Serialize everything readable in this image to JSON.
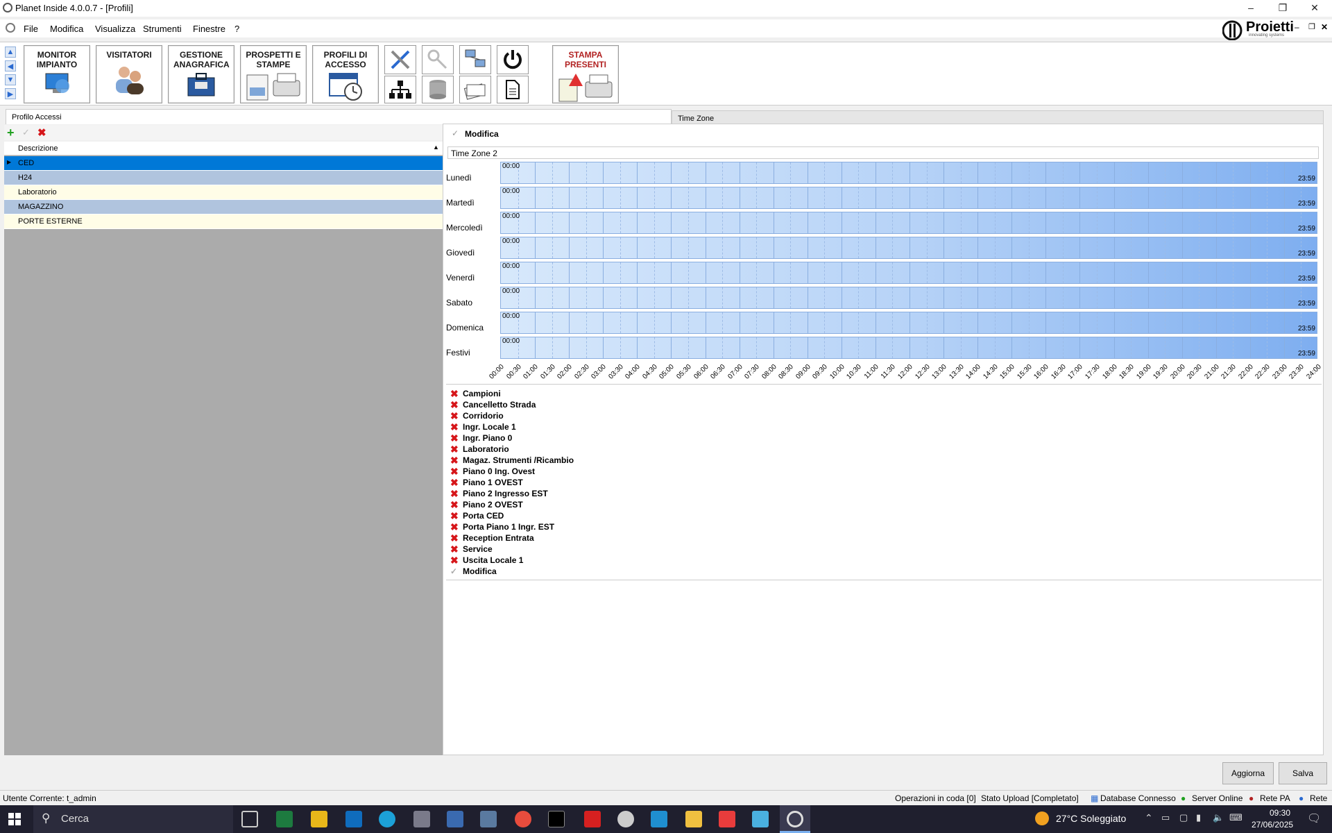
{
  "window": {
    "title": "Planet Inside 4.0.0.7 - [Profili]"
  },
  "menu": [
    "File",
    "Modifica",
    "Visualizza",
    "Strumenti",
    "Finestre",
    "?"
  ],
  "brand": {
    "name": "Proietti",
    "tagline": "innovating systems"
  },
  "toolbar": {
    "monitor": "MONITOR IMPIANTO",
    "visitatori": "VISITATORI",
    "anagrafica": "GESTIONE ANAGRAFICA",
    "prospetti": "PROSPETTI E STAMPE",
    "profili": "PROFILI DI ACCESSO",
    "stampa": "STAMPA PRESENTI"
  },
  "tabs": {
    "left": "Profilo Accessi",
    "right": "Time Zone"
  },
  "grid": {
    "header": "Descrizione",
    "rows": [
      "CED",
      "H24",
      "Laboratorio",
      "MAGAZZINO",
      "PORTE ESTERNE"
    ],
    "selected": 0,
    "colors": {
      "selected": "#0078d7",
      "even": "#b0c4de",
      "odd": "#fffde7"
    }
  },
  "detail": {
    "modifica_label": "Modifica",
    "timezone_name": "Time Zone 2",
    "days": [
      "Lunedì",
      "Martedì",
      "Mercoledì",
      "Giovedì",
      "Venerdì",
      "Sabato",
      "Domenica",
      "Festivi"
    ],
    "start": "00:00",
    "end": "23:59",
    "hours": [
      "00:00",
      "00:30",
      "01:00",
      "01:30",
      "02:00",
      "02:30",
      "03:00",
      "03:30",
      "04:00",
      "04:30",
      "05:00",
      "05:30",
      "06:00",
      "06:30",
      "07:00",
      "07:30",
      "08:00",
      "08:30",
      "09:00",
      "09:30",
      "10:00",
      "10:30",
      "11:00",
      "11:30",
      "12:00",
      "12:30",
      "13:00",
      "13:30",
      "14:00",
      "14:30",
      "15:00",
      "15:30",
      "16:00",
      "16:30",
      "17:00",
      "17:30",
      "18:00",
      "18:30",
      "19:00",
      "19:30",
      "20:00",
      "20:30",
      "21:00",
      "21:30",
      "22:00",
      "22:30",
      "23:00",
      "23:30",
      "24:00"
    ],
    "doors": [
      "Campioni",
      "Cancelletto Strada",
      "Corridorio",
      "Ingr. Locale 1",
      "Ingr. Piano 0",
      "Laboratorio",
      "Magaz. Strumenti /Ricambio",
      "Piano 0 Ing. Ovest",
      "Piano 1 OVEST",
      "Piano 2 Ingresso EST",
      "Piano 2 OVEST",
      "Porta CED",
      "Porta Piano 1 Ingr. EST",
      "Reception Entrata",
      "Service",
      "Uscita Locale 1"
    ],
    "doors_footer": "Modifica"
  },
  "buttons": {
    "aggiorna": "Aggiorna",
    "salva": "Salva"
  },
  "status": {
    "user": "Utente Corrente: t_admin",
    "queue": "Operazioni in coda [0]",
    "upload": "Stato Upload [Completato]",
    "db": "Database Connesso",
    "server": "Server Online",
    "rete_pa": "Rete PA",
    "rete": "Rete"
  },
  "taskbar": {
    "search": "Cerca",
    "weather": "27°C  Soleggiato",
    "time": "09:30",
    "date": "27/06/2025"
  }
}
